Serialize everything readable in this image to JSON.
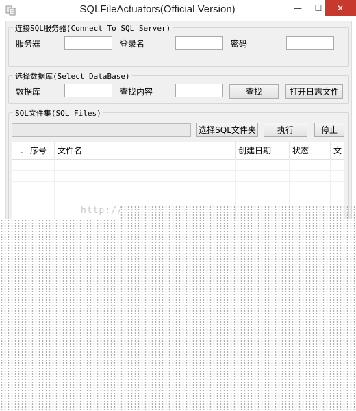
{
  "window": {
    "title": "SQLFileActuators(Official Version)",
    "minimize_glyph": "—",
    "maximize_glyph": "☐",
    "close_glyph": "✕"
  },
  "connect_group": {
    "legend": "连接SQL服务器(Connect To SQL Server)",
    "server_label": "服务器",
    "server_value": "",
    "login_label": "登录名",
    "login_value": "",
    "password_label": "密码",
    "password_value": ""
  },
  "database_group": {
    "legend": "选择数据库(Select DataBase)",
    "database_label": "数据库",
    "database_value": "",
    "search_label": "查找内容",
    "search_value": "",
    "find_button": "查找",
    "open_log_button": "打开日志文件"
  },
  "files_group": {
    "legend": "SQL文件集(SQL Files)",
    "path_value": "",
    "select_folder_button": "选择SQL文件夹",
    "execute_button": "执行",
    "stop_button": "停止"
  },
  "grid": {
    "columns": [
      ".",
      "序号",
      "文件名",
      "创建日期",
      "状态",
      "文"
    ]
  },
  "watermark": "http://"
}
